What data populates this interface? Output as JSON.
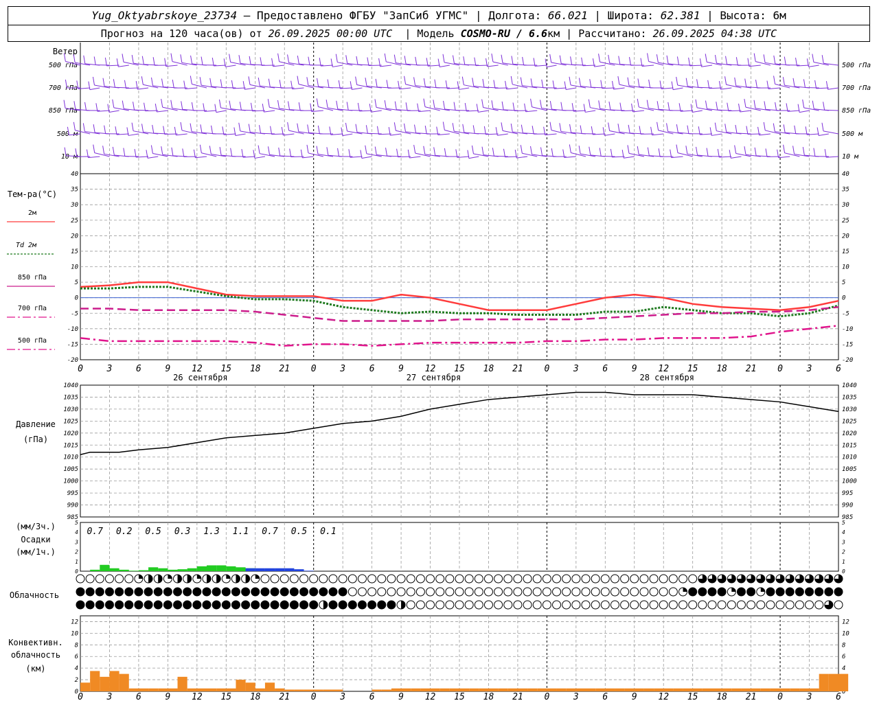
{
  "header": {
    "station": "Yug_Oktyabrskoye_23734",
    "provided": " – Предоставлено ФГБУ \"ЗапСиб УГМС\"",
    "lon_label": "Долгота:",
    "lon": "66.021",
    "lat_label": "Широта:",
    "lat": "62.381",
    "alt_label": "Высота:",
    "alt": "6м",
    "forecast_label": "Прогноз на 120 часа(ов) от",
    "forecast_from": "26.09.2025 00:00 UTC",
    "model_label": "Модель",
    "model": "COSMO-RU / 6.6",
    "model_unit": "км",
    "calc_label": "Рассчитано:",
    "calc": "26.09.2025 04:38 UTC"
  },
  "wind": {
    "title": "Ветер",
    "levels": [
      "500 гПа",
      "700 гПа",
      "850 гПа",
      "500 м",
      "10  м"
    ],
    "right_levels": [
      "500 гПа",
      "700 гПа",
      "850 гПа",
      "500 м",
      "10  м"
    ],
    "color": "#7d2fd8"
  },
  "temp": {
    "title": "Тем-ра(°C)",
    "legend": [
      {
        "label": "2м",
        "color": "#ff3b3b"
      },
      {
        "label": "Td  2м",
        "color": "#1f7a1f"
      },
      {
        "label": "850 гПа",
        "color": "#cc1c8c"
      },
      {
        "label": "700 гПа",
        "color": "#e0148c"
      },
      {
        "label": "500 гПа",
        "color": "#e0148c"
      }
    ]
  },
  "time_axis": {
    "hours": [
      "0",
      "3",
      "6",
      "9",
      "12",
      "15",
      "18",
      "21",
      "0",
      "3",
      "6",
      "9",
      "12",
      "15",
      "18",
      "21",
      "0",
      "3",
      "6",
      "9",
      "12",
      "15",
      "18",
      "21",
      "0",
      "3",
      "6"
    ],
    "dates": [
      "26 сентября",
      "27 сентября",
      "28 сентября"
    ]
  },
  "pressure": {
    "title": "Давление",
    "unit": "(гПа)"
  },
  "precip": {
    "unit1": "(мм/3ч.)",
    "title": "Осадки",
    "unit2": "(мм/1ч.)",
    "totals": [
      "0.7",
      "0.2",
      "0.5",
      "0.3",
      "1.3",
      "1.1",
      "0.7",
      "0.5",
      "0.1"
    ],
    "colors": {
      "rain": "#22cc22",
      "snow": "#2244dd"
    }
  },
  "cloud": {
    "title": "Облачность"
  },
  "conv": {
    "title1": "Конвективн.",
    "title2": "облачность",
    "unit": "(км)",
    "color": "#f08a24"
  },
  "chart_data": [
    {
      "type": "line",
      "title": "Тем-ра(°C)",
      "x_unit": "hours since 26.09.2025 00:00 UTC",
      "ylim": [
        -20,
        40
      ],
      "yticks": [
        -20,
        -15,
        -10,
        -5,
        0,
        5,
        10,
        15,
        20,
        25,
        30,
        35,
        40
      ],
      "series": [
        {
          "name": "2м",
          "x": [
            0,
            3,
            6,
            9,
            12,
            15,
            18,
            21,
            24,
            27,
            30,
            33,
            36,
            39,
            42,
            45,
            48,
            51,
            54,
            57,
            60,
            63,
            66,
            69,
            72,
            75,
            78
          ],
          "values": [
            3.5,
            4,
            5,
            5,
            3,
            1,
            0.5,
            0.5,
            0.5,
            -1,
            -1,
            1,
            0,
            -2,
            -4,
            -4,
            -4,
            -2,
            0,
            1,
            0,
            -2,
            -3,
            -3.5,
            -4,
            -3,
            -1
          ]
        },
        {
          "name": "Td  2м",
          "x": [
            0,
            3,
            6,
            9,
            12,
            15,
            18,
            21,
            24,
            27,
            30,
            33,
            36,
            39,
            42,
            45,
            48,
            51,
            54,
            57,
            60,
            63,
            66,
            69,
            72,
            75,
            78
          ],
          "values": [
            3,
            3,
            3.5,
            3.5,
            2,
            0.5,
            -0.5,
            -0.5,
            -1,
            -3,
            -4,
            -5,
            -4.5,
            -5,
            -5,
            -5.5,
            -5.5,
            -5.5,
            -4.5,
            -4.5,
            -3,
            -4,
            -5,
            -5,
            -6,
            -5,
            -2.5
          ]
        },
        {
          "name": "850 гПа",
          "x": [
            0,
            3,
            6,
            9,
            12,
            15,
            18,
            21,
            24,
            27,
            30,
            33,
            36,
            39,
            42,
            45,
            48,
            51,
            54,
            57,
            60,
            63,
            66,
            69,
            72,
            75,
            78
          ],
          "values": [
            -3.5,
            -3.5,
            -4,
            -4,
            -4,
            -4,
            -4.5,
            -5.5,
            -6.5,
            -7.5,
            -7.5,
            -7.5,
            -7.5,
            -7,
            -7,
            -7,
            -7,
            -7,
            -6.5,
            -6,
            -5.5,
            -5,
            -5,
            -4.5,
            -4.5,
            -4,
            -3
          ]
        },
        {
          "name": "500 гПа",
          "x": [
            0,
            3,
            6,
            9,
            12,
            15,
            18,
            21,
            24,
            27,
            30,
            33,
            36,
            39,
            42,
            45,
            48,
            51,
            54,
            57,
            60,
            63,
            66,
            69,
            72,
            75,
            78
          ],
          "values": [
            -13,
            -14,
            -14,
            -14,
            -14,
            -14,
            -14.5,
            -15.5,
            -15,
            -15,
            -15.5,
            -15,
            -14.5,
            -14.5,
            -14.5,
            -14.5,
            -14,
            -14,
            -13.5,
            -13.5,
            -13,
            -13,
            -13,
            -12.5,
            -11,
            -10,
            -9
          ]
        }
      ],
      "zero_line": true
    },
    {
      "type": "line",
      "title": "Давление",
      "ylim": [
        985,
        1040
      ],
      "yticks": [
        985,
        990,
        995,
        1000,
        1005,
        1010,
        1015,
        1020,
        1025,
        1030,
        1035,
        1040
      ],
      "series": [
        {
          "x": [
            0,
            1,
            2,
            3,
            4,
            5,
            6,
            9,
            12,
            15,
            18,
            21,
            24,
            27,
            30,
            33,
            36,
            39,
            42,
            45,
            48,
            51,
            54,
            57,
            60,
            63,
            66,
            69,
            72,
            75,
            78
          ],
          "values": [
            1011,
            1012,
            1012,
            1012,
            1012,
            1012.5,
            1013,
            1014,
            1016,
            1018,
            1019,
            1020,
            1022,
            1024,
            1025,
            1027,
            1030,
            1032,
            1034,
            1035,
            1036,
            1037,
            1037,
            1036,
            1036,
            1036,
            1035,
            1034,
            1033,
            1031,
            1029
          ]
        }
      ]
    },
    {
      "type": "bar",
      "title": "Осадки",
      "ylim": [
        0,
        5
      ],
      "yticks": [
        0,
        1,
        2,
        3,
        4,
        5
      ],
      "series": [
        {
          "name": "rain",
          "x": [
            0,
            1,
            2,
            3,
            4,
            5,
            6,
            7,
            8,
            9,
            10,
            11,
            12,
            13,
            14,
            15,
            16,
            17
          ],
          "values": [
            0,
            0.15,
            0.65,
            0.3,
            0.15,
            0.05,
            0.1,
            0.4,
            0.3,
            0.15,
            0.2,
            0.3,
            0.5,
            0.6,
            0.6,
            0.5,
            0.4,
            0.3
          ]
        },
        {
          "name": "snow",
          "x": [
            17,
            18,
            19,
            20,
            21,
            22,
            23
          ],
          "values": [
            0.3,
            0.3,
            0.3,
            0.3,
            0.3,
            0.2,
            0.05
          ]
        }
      ]
    },
    {
      "type": "bar",
      "title": "Конвективн. облачность",
      "ylim": [
        0,
        13
      ],
      "yticks": [
        0,
        2,
        4,
        6,
        8,
        10,
        12
      ],
      "series": [
        {
          "x": [
            0,
            1,
            2,
            3,
            4,
            5,
            6,
            7,
            8,
            9,
            10,
            11,
            12,
            13,
            14,
            15,
            16,
            17,
            18,
            19,
            20,
            21,
            22,
            23,
            24,
            25,
            26,
            30,
            31,
            32,
            33,
            34,
            35,
            36,
            37,
            38,
            39,
            40,
            41,
            42,
            43,
            44,
            45,
            46,
            47,
            48,
            49,
            50,
            51,
            52,
            53,
            54,
            55,
            56,
            57,
            58,
            59,
            60,
            61,
            62,
            63,
            64,
            65,
            66,
            67,
            68,
            69,
            70,
            71,
            72,
            73,
            74,
            75,
            76,
            77,
            78
          ],
          "values": [
            1.5,
            3.5,
            2.5,
            3.5,
            3,
            0.5,
            0.5,
            0.5,
            0.5,
            0.5,
            2.5,
            0.5,
            0.5,
            0.5,
            0.5,
            0.5,
            2,
            1.5,
            0.5,
            1.5,
            0.5,
            0.3,
            0.3,
            0.3,
            0.3,
            0.3,
            0.3,
            0.3,
            0.3,
            0.5,
            0.5,
            0.5,
            0.5,
            0.5,
            0.5,
            0.5,
            0.5,
            0.5,
            0.5,
            0.5,
            0.5,
            0.5,
            0.5,
            0.5,
            0.5,
            0.5,
            0.5,
            0.5,
            0.5,
            0.5,
            0.5,
            0.5,
            0.5,
            0.5,
            0.5,
            0.5,
            0.5,
            0.5,
            0.5,
            0.5,
            0.5,
            0.5,
            0.5,
            0.5,
            0.5,
            0.5,
            0.5,
            0.5,
            0.5,
            0.5,
            0.5,
            0.5,
            0.5,
            3,
            3,
            3
          ]
        }
      ]
    }
  ]
}
